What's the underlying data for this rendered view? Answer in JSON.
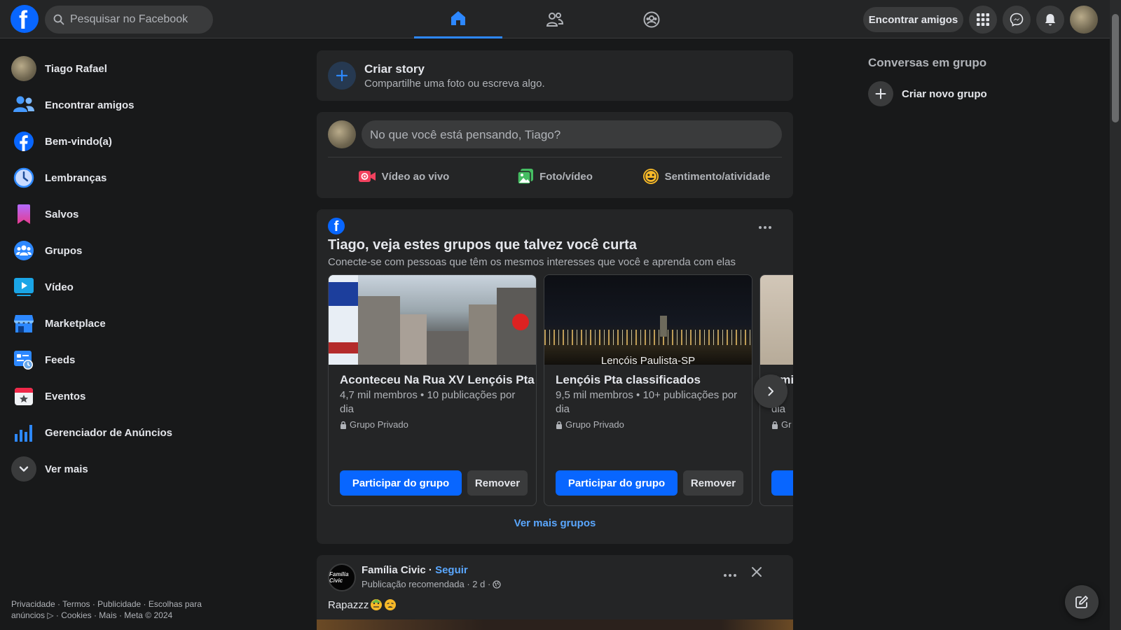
{
  "header": {
    "logo_letter": "f",
    "search_placeholder": "Pesquisar no Facebook",
    "find_friends_label": "Encontrar amigos",
    "nav_tabs": [
      "home-icon",
      "friends-icon",
      "groups-icon"
    ],
    "active_tab": "home",
    "accent_color": "#2d88ff"
  },
  "sidebar": {
    "items": [
      {
        "label": "Tiago Rafael",
        "icon": "profile-avatar"
      },
      {
        "label": "Encontrar amigos",
        "icon": "friends-icon"
      },
      {
        "label": "Bem-vindo(a)",
        "icon": "facebook-icon"
      },
      {
        "label": "Lembranças",
        "icon": "clock-icon"
      },
      {
        "label": "Salvos",
        "icon": "bookmark-icon"
      },
      {
        "label": "Grupos",
        "icon": "groups-icon"
      },
      {
        "label": "Vídeo",
        "icon": "video-icon"
      },
      {
        "label": "Marketplace",
        "icon": "marketplace-icon"
      },
      {
        "label": "Feeds",
        "icon": "feeds-icon"
      },
      {
        "label": "Eventos",
        "icon": "events-icon"
      },
      {
        "label": "Gerenciador de Anúncios",
        "icon": "ads-chart-icon"
      },
      {
        "label": "Ver mais",
        "icon": "chevron-down-icon"
      }
    ],
    "footer_line1": "Privacidade · Termos · Publicidade · Escolhas para",
    "footer_line2": "anúncios ▷ · Cookies · Mais · Meta © 2024"
  },
  "story": {
    "title": "Criar story",
    "subtitle": "Compartilhe uma foto ou escreva algo."
  },
  "composer": {
    "placeholder": "No que você está pensando, Tiago?",
    "actions": [
      {
        "label": "Vídeo ao vivo",
        "icon": "live-video-icon"
      },
      {
        "label": "Foto/vídeo",
        "icon": "photo-icon"
      },
      {
        "label": "Sentimento/atividade",
        "icon": "feeling-icon"
      }
    ]
  },
  "groups_suggestion": {
    "title": "Tiago, veja estes grupos que talvez você curta",
    "subtitle": "Conecte-se com pessoas que têm os mesmos interesses que você e aprenda com elas",
    "cards": [
      {
        "name": "Aconteceu Na Rua XV Lençóis Pta",
        "meta": "4,7 mil membros • 10 publicações por dia",
        "privacy": "Grupo Privado",
        "join": "Participar do grupo",
        "remove": "Remover",
        "image_caption": ""
      },
      {
        "name": "Lençóis Pta classificados",
        "meta": "9,5 mil membros • 10+ publicações por dia",
        "privacy": "Grupo Privado",
        "join": "Participar do grupo",
        "remove": "Remover",
        "image_caption": "Lençóis Paulista-SP"
      },
      {
        "name": "Ami",
        "meta": "m",
        "meta2": "dia",
        "privacy": "Gr",
        "join": "Pa",
        "remove": "",
        "image_caption": ""
      }
    ],
    "see_more": "Ver mais grupos"
  },
  "post": {
    "author": "Família Civic",
    "separator": " · ",
    "follow": "Seguir",
    "meta": "Publicação recomendada · 2 d ·",
    "avatar_text": "Família Civic",
    "text": "Rapazzz"
  },
  "right_sidebar": {
    "title": "Conversas em grupo",
    "new_group": "Criar novo grupo"
  }
}
